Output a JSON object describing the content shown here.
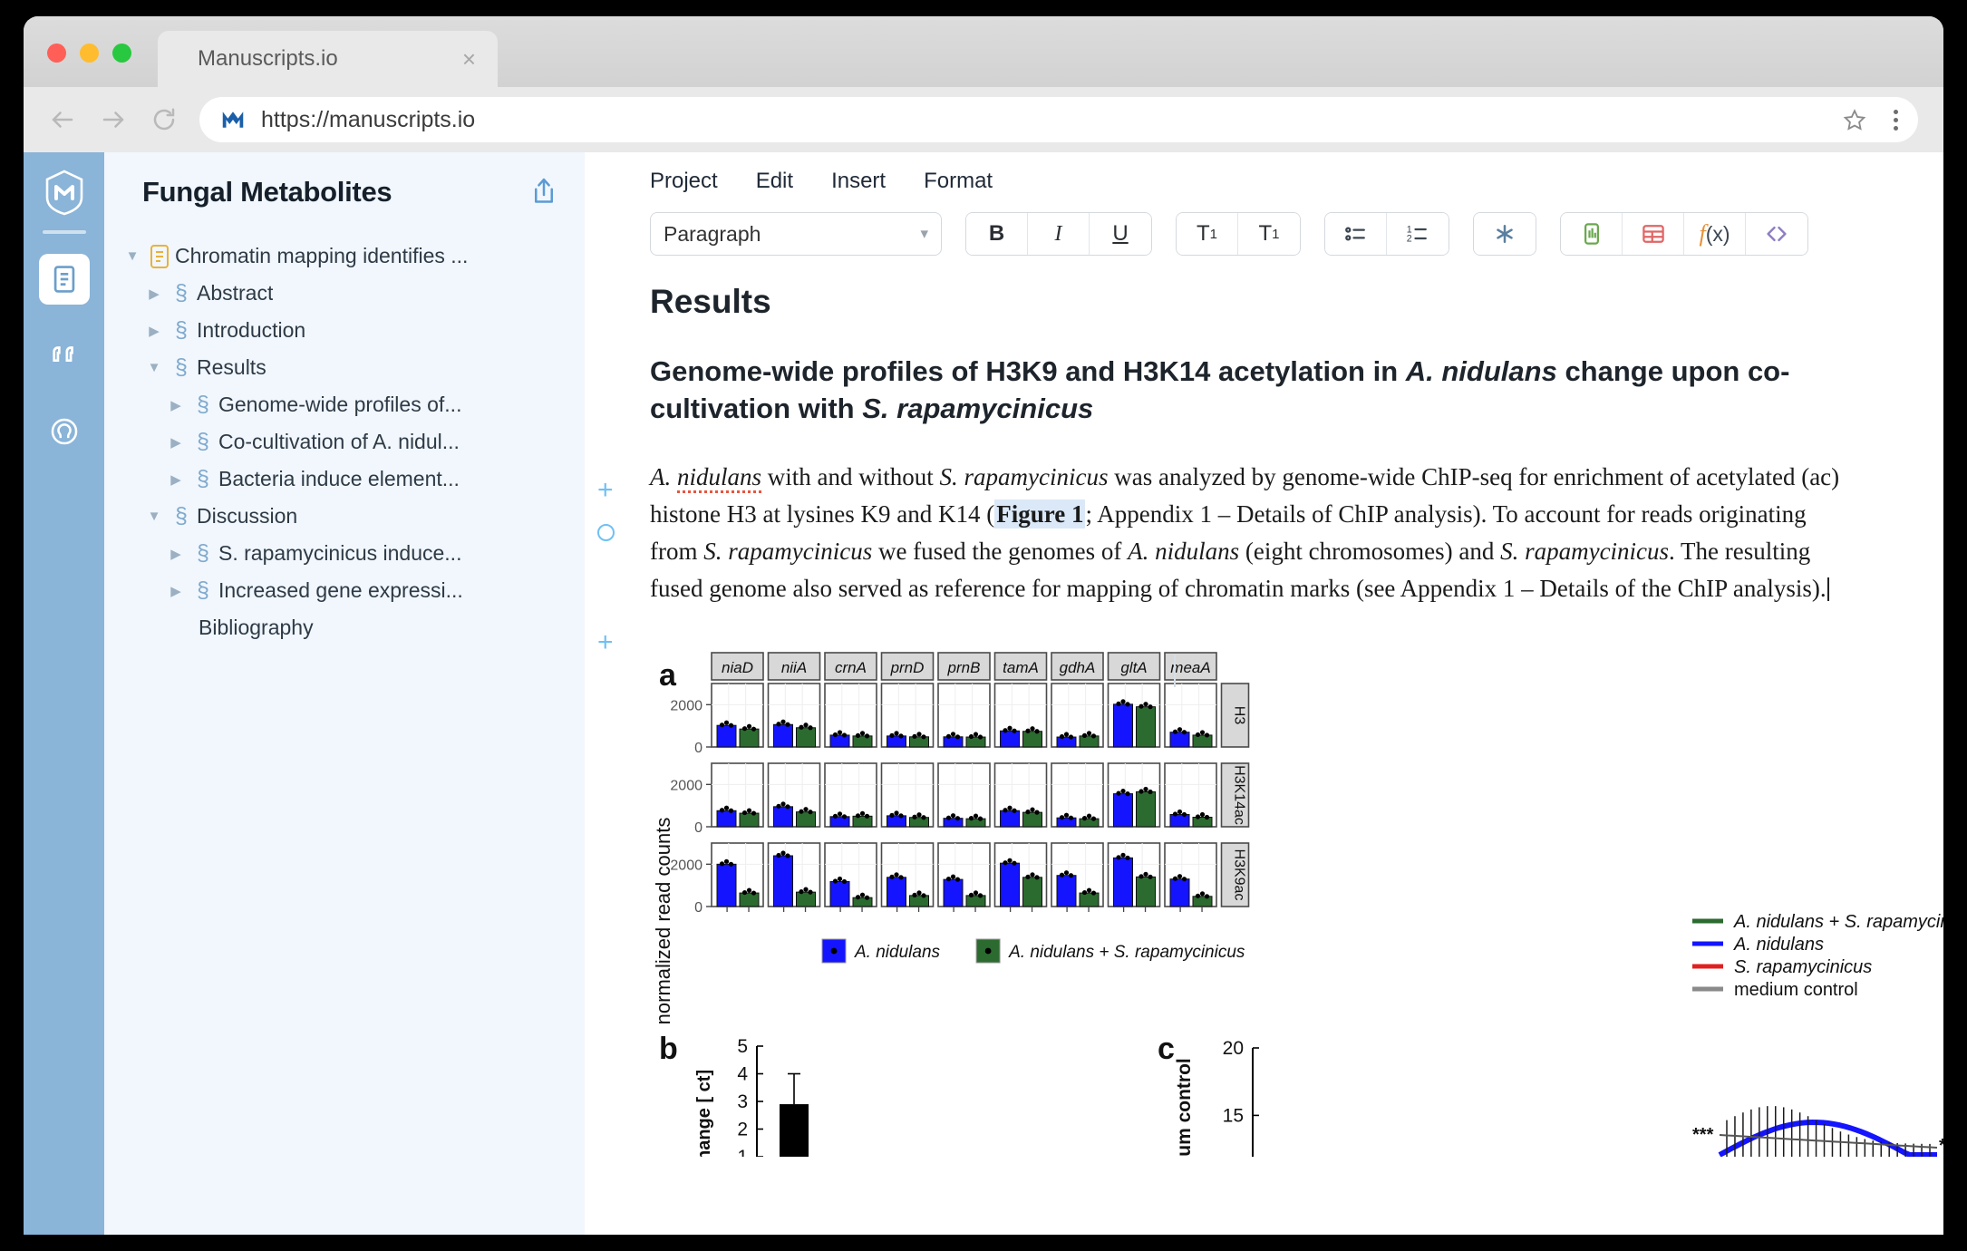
{
  "browser": {
    "tab_title": "Manuscripts.io",
    "close_label": "×",
    "url": "https://manuscripts.io",
    "back_icon": "back-arrow-icon",
    "forward_icon": "forward-arrow-icon",
    "reload_icon": "reload-icon",
    "site_icon": "manuscripts-m-icon",
    "bookmark_icon": "star-icon",
    "menu_icon": "kebab-menu-icon"
  },
  "rail": {
    "logo": "manuscripts-logo-icon",
    "items": [
      {
        "name": "document-icon",
        "active": true
      },
      {
        "name": "quotes-icon",
        "active": false
      },
      {
        "name": "user-icon",
        "active": false
      }
    ]
  },
  "outline": {
    "project_title": "Fungal Metabolites",
    "share_icon": "share-icon",
    "section_glyph": "§",
    "caret_open": "▼",
    "caret_closed": "▶",
    "items": [
      {
        "label": "Chromatin mapping identifies ...",
        "level": 1,
        "open": true,
        "type": "manuscript"
      },
      {
        "label": "Abstract",
        "level": 2,
        "open": false,
        "type": "section"
      },
      {
        "label": "Introduction",
        "level": 2,
        "open": false,
        "type": "section"
      },
      {
        "label": "Results",
        "level": 2,
        "open": true,
        "type": "section"
      },
      {
        "label": "Genome-wide profiles of...",
        "level": 3,
        "open": false,
        "type": "section"
      },
      {
        "label": "Co-cultivation of A. nidul...",
        "level": 3,
        "open": false,
        "type": "section"
      },
      {
        "label": "Bacteria induce element...",
        "level": 3,
        "open": false,
        "type": "section"
      },
      {
        "label": "Discussion",
        "level": 2,
        "open": true,
        "type": "section"
      },
      {
        "label": "S. rapamycinicus induce...",
        "level": 3,
        "open": false,
        "type": "section"
      },
      {
        "label": "Increased gene expressi...",
        "level": 3,
        "open": false,
        "type": "section"
      }
    ],
    "bibliography": "Bibliography"
  },
  "menubar": {
    "items": [
      "Project",
      "Edit",
      "Insert",
      "Format"
    ]
  },
  "toolbar": {
    "style_value": "Paragraph",
    "chevron": "▾",
    "bold": "B",
    "italic": "I",
    "underline": "U",
    "subscript_label": "T",
    "subscript_mark": "1",
    "superscript_label": "T",
    "superscript_mark": "1",
    "bullet_list_icon": "bullet-list-icon",
    "numbered_list_icon": "numbered-list-icon",
    "footnote_icon": "asterisk-icon",
    "figure_icon": "insert-figure-icon",
    "table_icon": "insert-table-icon",
    "equation_label": "f",
    "equation_arg": "(x)",
    "code_icon": "code-brackets-icon",
    "colors": {
      "figure": "#6aa84f",
      "table": "#e06666",
      "equation": "#e69138",
      "code": "#8e7cc3"
    }
  },
  "document": {
    "heading1": "Results",
    "heading2_parts": [
      {
        "text": "Genome-wide profiles of H3K9 and H3K14 acetylation in ",
        "italic": false
      },
      {
        "text": "A. nidulans",
        "italic": true
      },
      {
        "text": " change upon co-cultivation with ",
        "italic": false
      },
      {
        "text": "S. rapamycinicus",
        "italic": true
      }
    ],
    "paragraph_parts": [
      {
        "text": "A. ",
        "italic": true
      },
      {
        "text": "nidulans",
        "italic": true,
        "spellcheck": true
      },
      {
        "text": " with and without ",
        "italic": false
      },
      {
        "text": "S. rapamycinicus",
        "italic": true
      },
      {
        "text": " was analyzed by genome-wide ChIP-seq for enrichment of acetylated (ac) histone H3 at lysines K9 and K14 (",
        "italic": false
      },
      {
        "text": "Figure 1",
        "figref": true
      },
      {
        "text": "; Appendix 1 – Details of ChIP analysis). To account for reads originating from ",
        "italic": false
      },
      {
        "text": "S. rapamycinicus",
        "italic": true
      },
      {
        "text": " we fused the genomes of ",
        "italic": false
      },
      {
        "text": "A. nidulans",
        "italic": true
      },
      {
        "text": " (eight chromosomes) and ",
        "italic": false
      },
      {
        "text": "S. rapamycinicus",
        "italic": true
      },
      {
        "text": ". The resulting fused genome also served as reference for mapping of chromatin marks (see Appendix 1 – Details of the ChIP analysis).",
        "italic": false
      }
    ],
    "gutter_add": "+",
    "gutter_comment": "comment-marker-icon"
  },
  "chart_data": {
    "type": "bar",
    "panel_label": "a",
    "title": "",
    "ylabel": "normalized read counts",
    "xlabel": "",
    "ylim": [
      0,
      3000
    ],
    "yticks": [
      0,
      2000
    ],
    "ytick_labels": [
      "0",
      "2000"
    ],
    "categories": [
      "niaD",
      "niiA",
      "crnA",
      "prnD",
      "prnB",
      "tamA",
      "gdhA",
      "gltA",
      "meaA"
    ],
    "row_labels": [
      "H3",
      "H3K14ac",
      "H3K9ac"
    ],
    "legend_position": "bottom",
    "legend": [
      {
        "label": "A. nidulans",
        "color": "#1414ff",
        "marker": "square"
      },
      {
        "label": "A. nidulans + S. rapamycinicus",
        "color": "#2c6b2f",
        "marker": "square"
      }
    ],
    "series": [
      {
        "name": "A. nidulans",
        "color": "#1414ff",
        "rows": {
          "H3": [
            1020,
            1060,
            560,
            520,
            480,
            760,
            470,
            2020,
            700
          ],
          "H3K14ac": [
            760,
            950,
            480,
            520,
            400,
            760,
            420,
            1560,
            580
          ],
          "H3K9ac": [
            2000,
            2400,
            1180,
            1380,
            1280,
            2050,
            1470,
            2300,
            1300
          ]
        }
      },
      {
        "name": "A. nidulans + S. rapamycinicus",
        "color": "#2c6b2f",
        "rows": {
          "H3": [
            850,
            910,
            520,
            480,
            470,
            740,
            520,
            1900,
            560
          ],
          "H3K14ac": [
            640,
            700,
            500,
            440,
            380,
            680,
            380,
            1650,
            450
          ],
          "H3K9ac": [
            640,
            680,
            420,
            520,
            520,
            1380,
            640,
            1400,
            480
          ]
        }
      }
    ],
    "points_note": "three replicate dots plotted on each bar top"
  },
  "chart_b": {
    "type": "bar",
    "panel_label": "b",
    "ylabel_fragment": "change [ ct]",
    "yticks": [
      1,
      2,
      3,
      4,
      5
    ],
    "ytick_labels": [
      "1",
      "2",
      "3",
      "4",
      "5"
    ],
    "values": [
      2.9
    ],
    "errors": [
      1.1
    ],
    "bar_color": "#000000"
  },
  "chart_c": {
    "type": "line",
    "panel_label": "c",
    "ylabel": "medium control",
    "yticks": [
      15,
      20
    ],
    "ytick_labels": [
      "15",
      "20"
    ],
    "annotations": [
      "***",
      "***"
    ],
    "legend_position": "top-right",
    "legend": [
      {
        "label": "A. nidulans + S. rapamycinicus",
        "color": "#2c6b2f"
      },
      {
        "label": "A. nidulans",
        "color": "#1414ff"
      },
      {
        "label": "S. rapamycinicus",
        "color": "#e02020"
      },
      {
        "label": "medium control",
        "color": "#8a8a8a"
      }
    ]
  }
}
